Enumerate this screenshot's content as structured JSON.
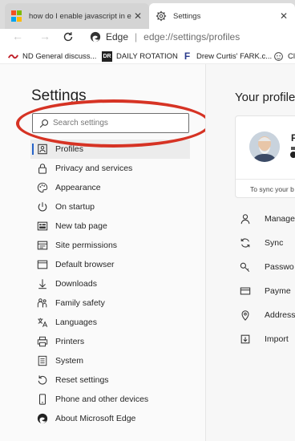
{
  "tabs": [
    {
      "title": "how do I enable javascript in edge",
      "close": "✕"
    },
    {
      "title": "Settings",
      "close": "✕"
    }
  ],
  "address": {
    "site": "Edge",
    "separator": "|",
    "url": "edge://settings/profiles"
  },
  "favorites": [
    {
      "label": "ND General discuss..."
    },
    {
      "label": "DAILY ROTATION"
    },
    {
      "label": "Drew Curtis' FARK.c..."
    },
    {
      "label": "Cli"
    }
  ],
  "settings": {
    "heading": "Settings",
    "search_placeholder": "Search settings",
    "menu": [
      {
        "label": "Profiles",
        "icon": "profile-icon",
        "active": true
      },
      {
        "label": "Privacy and services",
        "icon": "lock-icon"
      },
      {
        "label": "Appearance",
        "icon": "palette-icon"
      },
      {
        "label": "On startup",
        "icon": "power-icon"
      },
      {
        "label": "New tab page",
        "icon": "new-tab-icon"
      },
      {
        "label": "Site permissions",
        "icon": "site-permissions-icon"
      },
      {
        "label": "Default browser",
        "icon": "browser-icon"
      },
      {
        "label": "Downloads",
        "icon": "download-icon"
      },
      {
        "label": "Family safety",
        "icon": "family-icon"
      },
      {
        "label": "Languages",
        "icon": "languages-icon"
      },
      {
        "label": "Printers",
        "icon": "printer-icon"
      },
      {
        "label": "System",
        "icon": "system-icon"
      },
      {
        "label": "Reset settings",
        "icon": "reset-icon"
      },
      {
        "label": "Phone and other devices",
        "icon": "phone-icon"
      },
      {
        "label": "About Microsoft Edge",
        "icon": "edge-icon"
      }
    ]
  },
  "profile_pane": {
    "title": "Your profile",
    "card_initial": "F",
    "sync_text": "To sync your b",
    "items": [
      {
        "label": "Manage",
        "icon": "person-icon"
      },
      {
        "label": "Sync",
        "icon": "sync-icon"
      },
      {
        "label": "Passwo",
        "icon": "key-icon"
      },
      {
        "label": "Payme",
        "icon": "card-icon"
      },
      {
        "label": "Address",
        "icon": "location-icon"
      },
      {
        "label": "Import",
        "icon": "import-icon"
      }
    ]
  },
  "colors": {
    "annotation_circle": "#d63324",
    "active_indicator": "#2563c9"
  }
}
